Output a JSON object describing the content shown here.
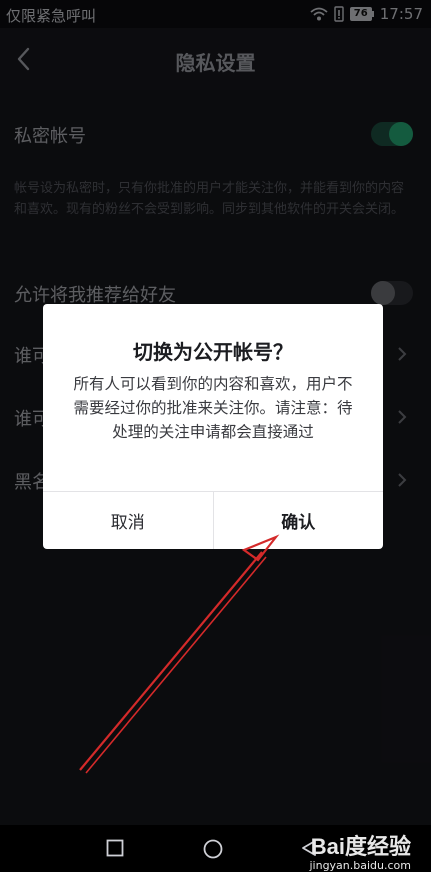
{
  "status_bar": {
    "left_text": "仅限紧急呼叫",
    "battery": "76",
    "time": "17:57",
    "icons": [
      "wifi-icon",
      "alert-icon",
      "battery-icon"
    ]
  },
  "nav": {
    "back_icon": "chevron-left-icon",
    "title": "隐私设置"
  },
  "settings": {
    "private_account": {
      "label": "私密帐号",
      "toggle_on": true
    },
    "private_account_desc": "帐号设为私密时，只有你批准的用户才能关注你，并能看到你的内容和喜欢。现有的粉丝不会受到影响。同步到其他软件的开关会关闭。",
    "recommend_to_friends": {
      "label": "允许将我推荐给好友",
      "toggle_on": false
    },
    "rows": [
      {
        "label": "谁可"
      },
      {
        "label": "谁可"
      },
      {
        "label": "黑名"
      }
    ]
  },
  "dialog": {
    "title": "切换为公开帐号？",
    "message": "所有人可以看到你的内容和喜欢，用户不需要经过你的批准来关注你。请注意：待处理的关注申请都会直接通过",
    "cancel_label": "取消",
    "confirm_label": "确认"
  },
  "system_nav": {
    "icons": [
      "recent-apps-icon",
      "home-icon",
      "back-icon"
    ]
  },
  "watermark": {
    "logo": "Bai度经验",
    "url": "jingyan.baidu.com"
  },
  "colors": {
    "toggle_on": "#26a674",
    "annotation_arrow": "#d42a2a"
  }
}
